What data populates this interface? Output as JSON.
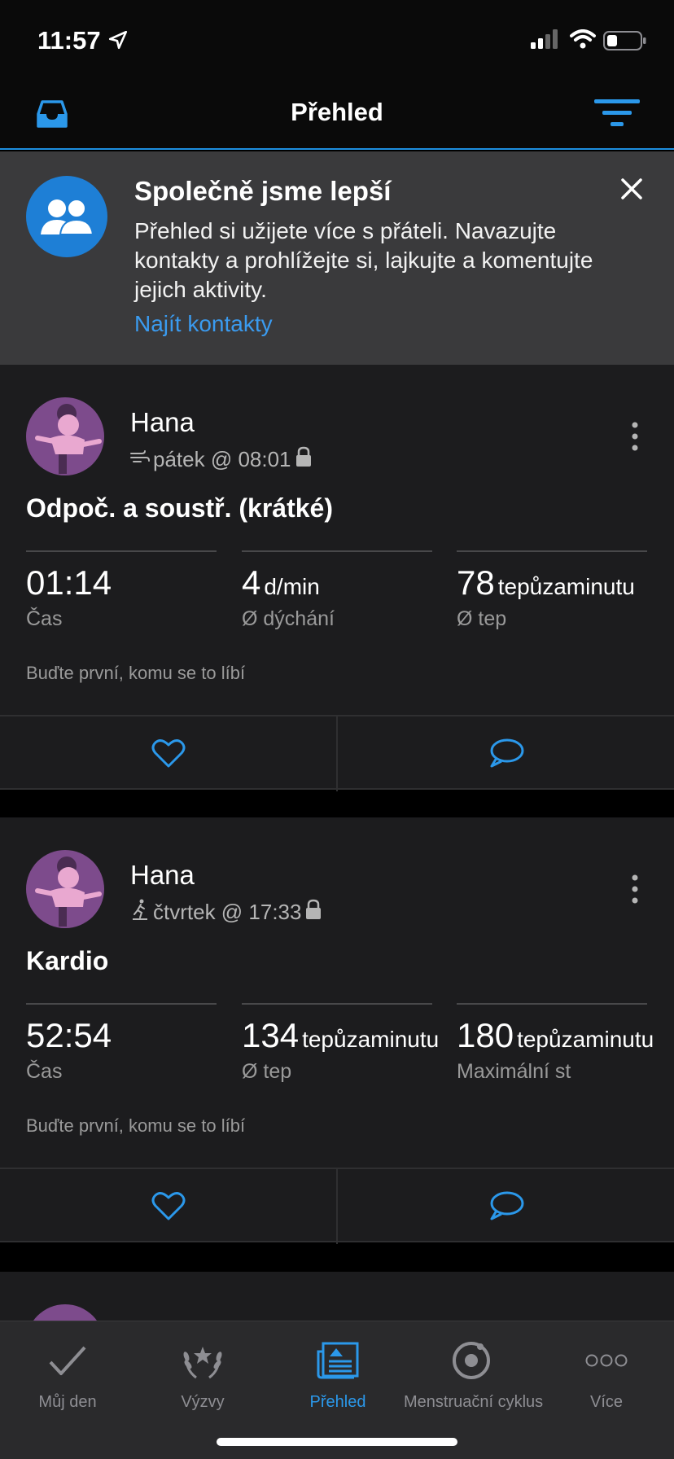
{
  "status_bar": {
    "time": "11:57"
  },
  "header": {
    "title": "Přehled"
  },
  "banner": {
    "title": "Společně jsme lepší",
    "text": "Přehled si užijete více s přáteli. Navazujte kontakty a prohlížejte si, lajkujte a komentujte jejich aktivity.",
    "link": "Najít kontakty"
  },
  "activities": [
    {
      "name": "Hana",
      "meta": "pátek @ 08:01",
      "activity_icon": "breathing-icon",
      "title": "Odpoč. a soustř. (krátké)",
      "stats": [
        {
          "value": "01:14",
          "unit": "",
          "label": "Čas"
        },
        {
          "value": "4",
          "unit": "d/min",
          "label": "Ø dýchání"
        },
        {
          "value": "78",
          "unit": "tepůzaminutu",
          "label": "Ø tep"
        }
      ],
      "likes_text": "Buďte první, komu se to líbí"
    },
    {
      "name": "Hana",
      "meta": "čtvrtek @ 17:33",
      "activity_icon": "treadmill-icon",
      "title": "Kardio",
      "stats": [
        {
          "value": "52:54",
          "unit": "",
          "label": "Čas"
        },
        {
          "value": "134",
          "unit": "tepůzaminutu",
          "label": "Ø tep"
        },
        {
          "value": "180",
          "unit": "tepůzaminutu",
          "label": "Maximální st"
        }
      ],
      "likes_text": "Buďte první, komu se to líbí"
    }
  ],
  "tabs": [
    {
      "label": "Můj den",
      "icon": "checkmark-icon",
      "active": false
    },
    {
      "label": "Výzvy",
      "icon": "laurel-icon",
      "active": false
    },
    {
      "label": "Přehled",
      "icon": "newsfeed-icon",
      "active": true
    },
    {
      "label": "Menstruační cyklus",
      "icon": "cycle-icon",
      "active": false
    },
    {
      "label": "Více",
      "icon": "more-dots-icon",
      "active": false
    }
  ],
  "colors": {
    "accent": "#2b98ea",
    "card": "#1c1c1e",
    "banner": "#3a3a3c",
    "avatar_bg": "#7d4b8c"
  }
}
